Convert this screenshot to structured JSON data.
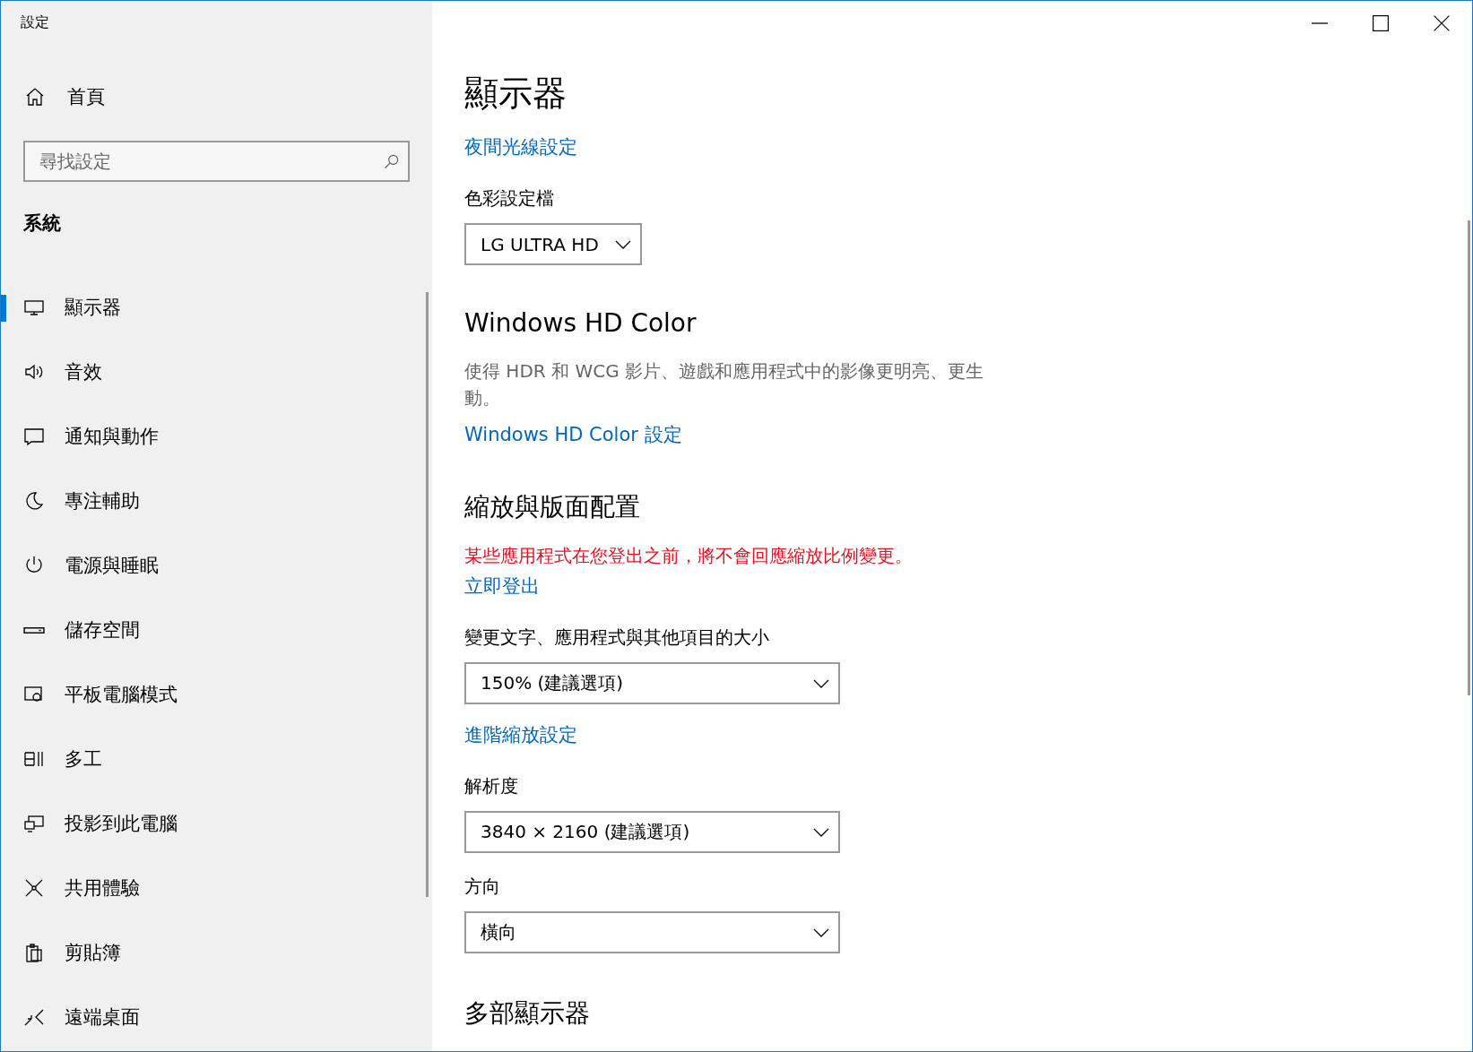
{
  "window": {
    "title": "設定"
  },
  "sidebar": {
    "home": "首頁",
    "search": {
      "placeholder": "尋找設定"
    },
    "section": "系統",
    "items": [
      {
        "label": "顯示器",
        "selected": true
      },
      {
        "label": "音效",
        "selected": false
      },
      {
        "label": "通知與動作",
        "selected": false
      },
      {
        "label": "專注輔助",
        "selected": false
      },
      {
        "label": "電源與睡眠",
        "selected": false
      },
      {
        "label": "儲存空間",
        "selected": false
      },
      {
        "label": "平板電腦模式",
        "selected": false
      },
      {
        "label": "多工",
        "selected": false
      },
      {
        "label": "投影到此電腦",
        "selected": false
      },
      {
        "label": "共用體驗",
        "selected": false
      },
      {
        "label": "剪貼簿",
        "selected": false
      },
      {
        "label": "遠端桌面",
        "selected": false
      }
    ]
  },
  "content": {
    "title": "顯示器",
    "blocks": [
      {
        "kind": "link",
        "text": "夜間光線設定"
      },
      {
        "kind": "label",
        "text": "色彩設定檔"
      },
      {
        "kind": "dropdown",
        "value": "LG ULTRA HD",
        "wide": false
      },
      {
        "kind": "heading",
        "text": "Windows HD Color"
      },
      {
        "kind": "desc",
        "text": "使得 HDR 和 WCG 影片、遊戲和應用程式中的影像更明亮、更生動。"
      },
      {
        "kind": "link",
        "text": "Windows HD Color 設定"
      },
      {
        "kind": "heading",
        "text": "縮放與版面配置"
      },
      {
        "kind": "warning",
        "text": "某些應用程式在您登出之前，將不會回應縮放比例變更。"
      },
      {
        "kind": "link",
        "text": "立即登出"
      },
      {
        "kind": "label",
        "text": "變更文字、應用程式與其他項目的大小"
      },
      {
        "kind": "dropdown",
        "value": "150% (建議選項)",
        "wide": true
      },
      {
        "kind": "link",
        "text": "進階縮放設定"
      },
      {
        "kind": "label",
        "text": "解析度"
      },
      {
        "kind": "dropdown",
        "value": "3840 × 2160 (建議選項)",
        "wide": true
      },
      {
        "kind": "label",
        "text": "方向"
      },
      {
        "kind": "dropdown",
        "value": "橫向",
        "wide": true
      },
      {
        "kind": "heading",
        "text": "多部顯示器"
      }
    ]
  }
}
